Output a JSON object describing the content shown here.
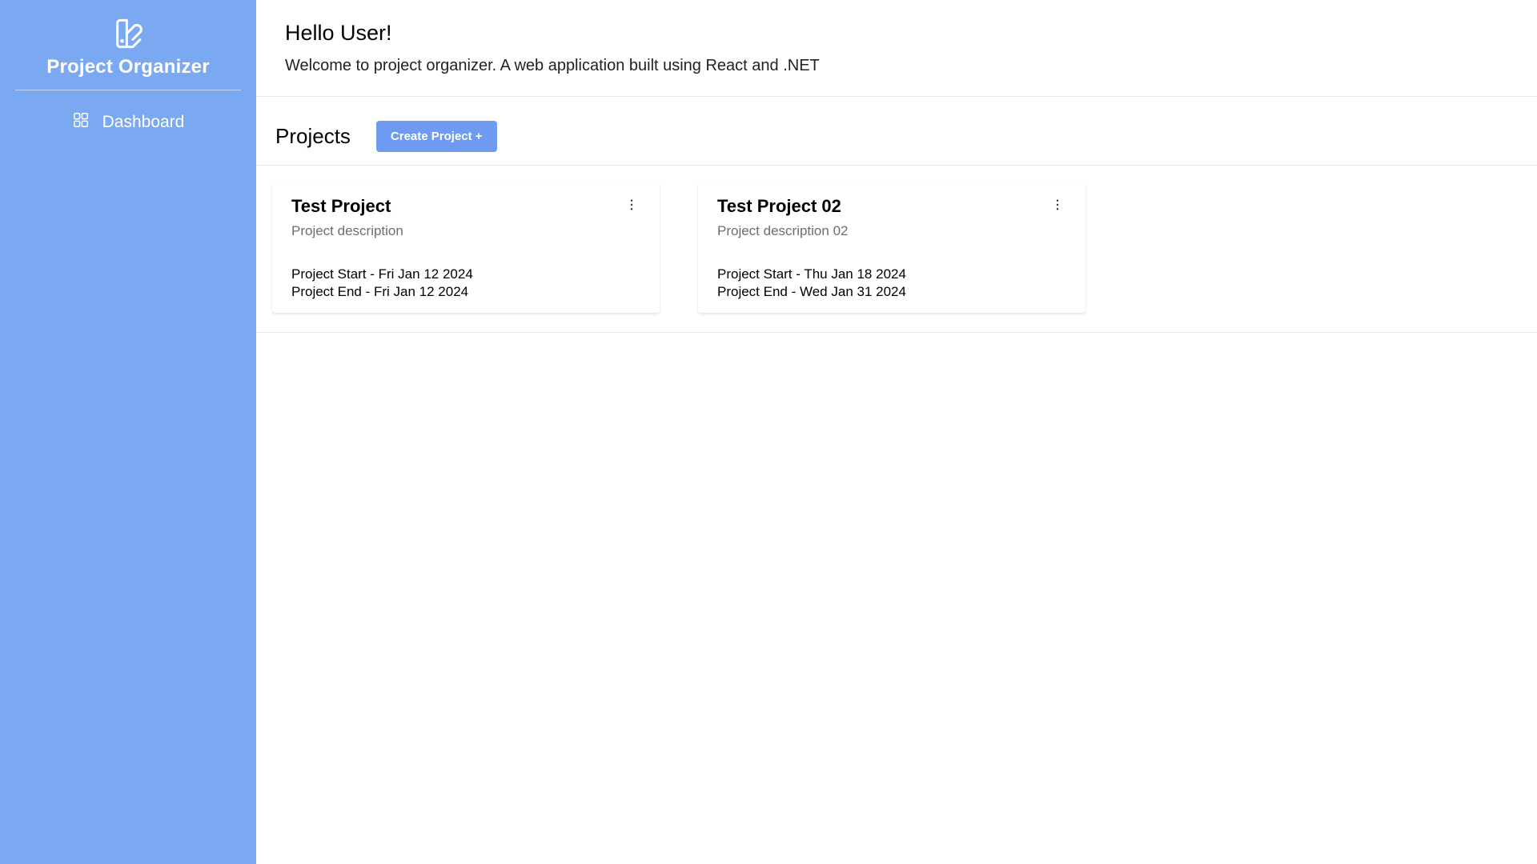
{
  "sidebar": {
    "title": "Project Organizer",
    "items": [
      {
        "label": "Dashboard"
      }
    ]
  },
  "welcome": {
    "title": "Hello User!",
    "subtitle": "Welcome to project organizer. A web application built using React and .NET"
  },
  "projects": {
    "title": "Projects",
    "create_label": "Create Project +",
    "items": [
      {
        "title": "Test Project",
        "description": "Project description",
        "start": "Project Start - Fri Jan 12 2024",
        "end": "Project End - Fri Jan 12 2024"
      },
      {
        "title": "Test Project 02",
        "description": "Project description 02",
        "start": "Project Start - Thu Jan 18 2024",
        "end": "Project End - Wed Jan 31 2024"
      }
    ]
  }
}
